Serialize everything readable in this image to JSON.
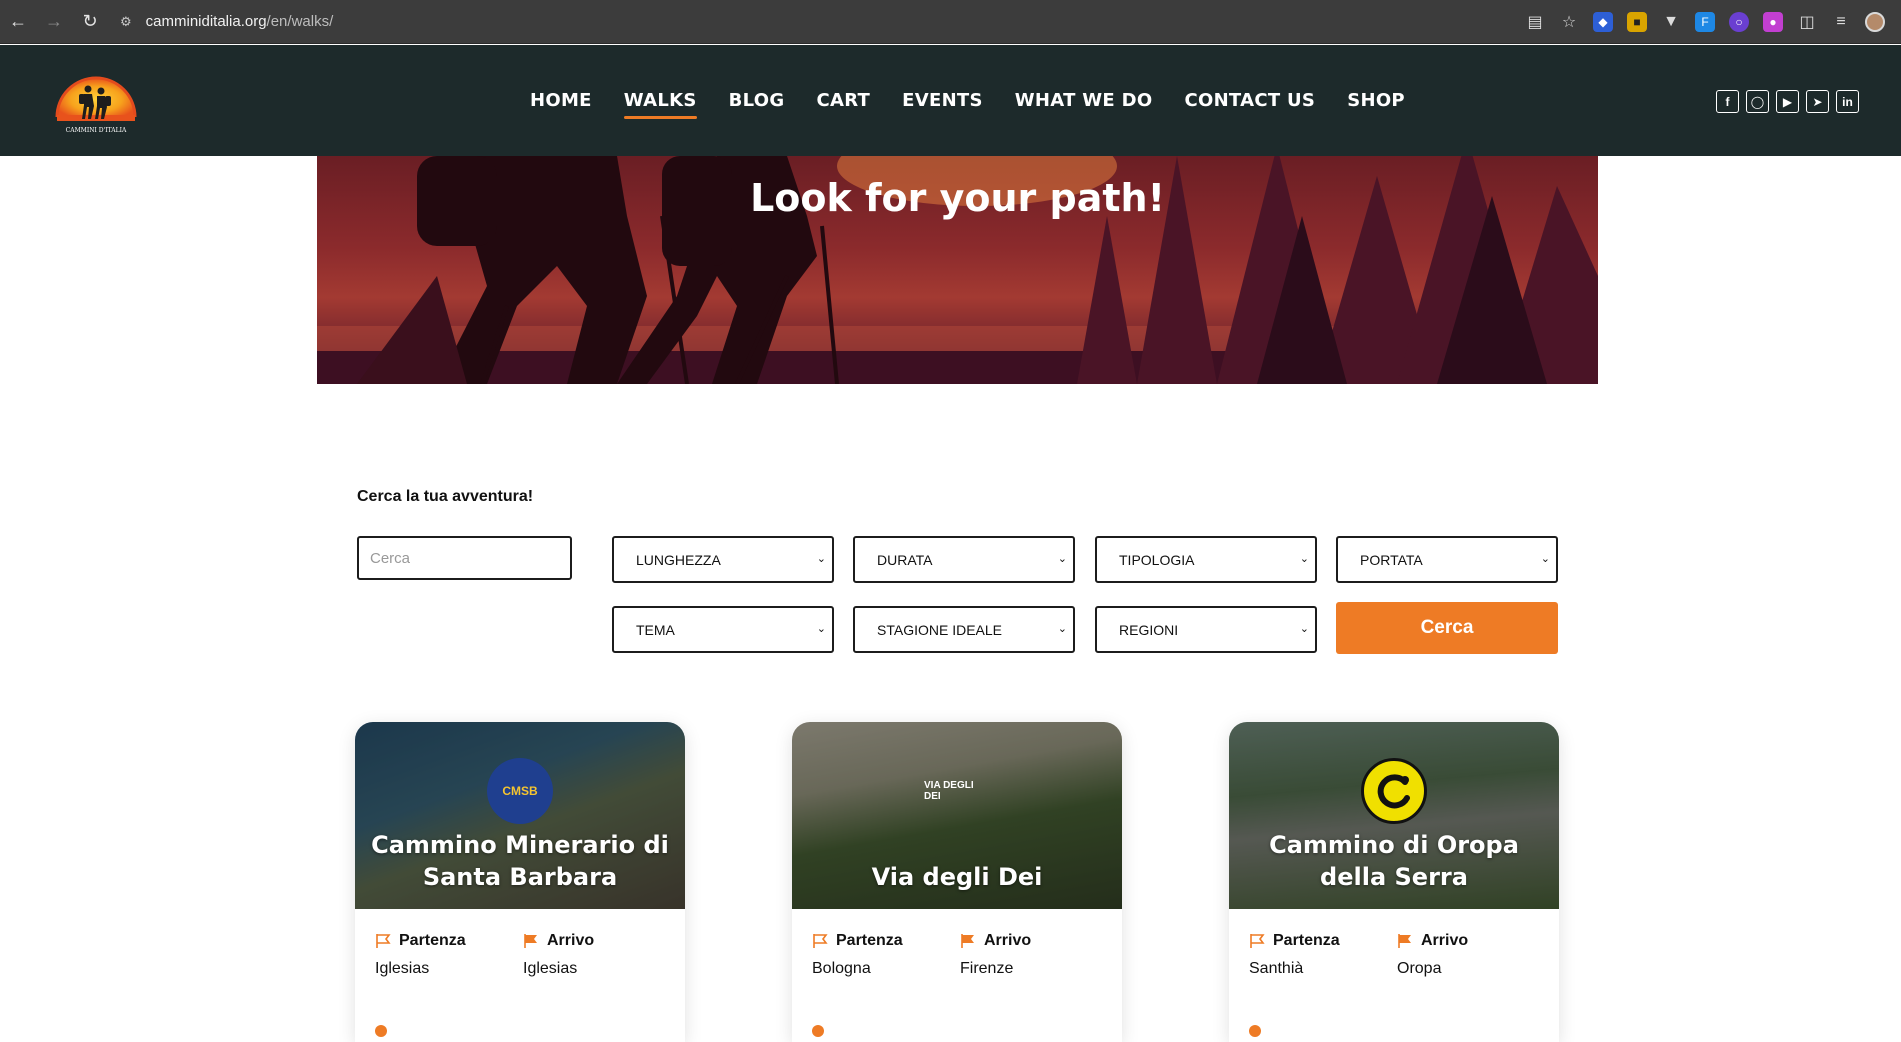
{
  "browser": {
    "url_host": "camminiditalia.org",
    "url_path": "/en/walks/"
  },
  "site": {
    "logo_text": "CAMMINI D'ITALIA",
    "nav": [
      {
        "label": "HOME"
      },
      {
        "label": "WALKS",
        "active": true
      },
      {
        "label": "BLOG"
      },
      {
        "label": "CART"
      },
      {
        "label": "EVENTS"
      },
      {
        "label": "WHAT WE DO"
      },
      {
        "label": "CONTACT US"
      },
      {
        "label": "SHOP"
      }
    ],
    "socials": [
      "facebook-icon",
      "instagram-icon",
      "youtube-icon",
      "telegram-icon",
      "linkedin-icon"
    ]
  },
  "hero": {
    "title": "Look for your path!"
  },
  "search": {
    "title": "Cerca la tua avventura!",
    "placeholder": "Cerca",
    "filters_row1": [
      "LUNGHEZZA",
      "DURATA",
      "TIPOLOGIA",
      "PORTATA"
    ],
    "filters_row2": [
      "TEMA",
      "STAGIONE IDEALE",
      "REGIONI"
    ],
    "button": "Cerca"
  },
  "cards": [
    {
      "title": "Cammino Minerario di Santa Barbara",
      "badge": "CMSB",
      "start_label": "Partenza",
      "start": "Iglesias",
      "end_label": "Arrivo",
      "end": "Iglesias"
    },
    {
      "title": "Via degli Dei",
      "badge": "VIA DEGLI DEI",
      "start_label": "Partenza",
      "start": "Bologna",
      "end_label": "Arrivo",
      "end": "Firenze"
    },
    {
      "title": "Cammino di Oropa della Serra",
      "badge": "",
      "start_label": "Partenza",
      "start": "Santhià",
      "end_label": "Arrivo",
      "end": "Oropa"
    }
  ],
  "colors": {
    "accent": "#ee7b25",
    "header_bg": "#1d2a2b",
    "chrome_bg": "#3c3c3c"
  }
}
